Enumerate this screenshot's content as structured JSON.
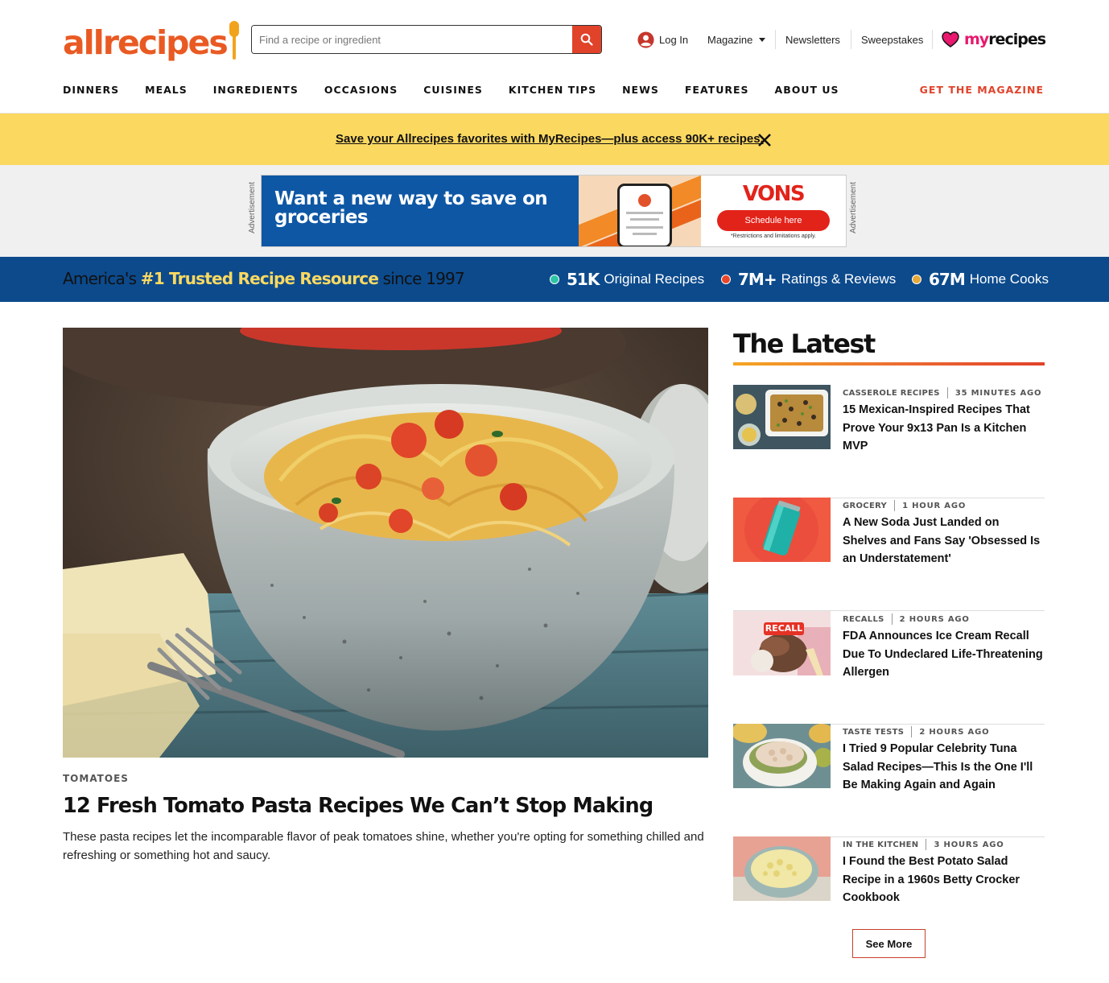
{
  "brand": {
    "logo_text": "allrecipes",
    "partner_logo_text_my": "my",
    "partner_logo_text_recipes": "recipes",
    "accent_color": "#e1422a"
  },
  "search": {
    "placeholder": "Find a recipe or ingredient",
    "icon": "search-icon"
  },
  "utility_nav": {
    "login": "Log In",
    "magazine": "Magazine",
    "newsletters": "Newsletters",
    "sweepstakes": "Sweepstakes"
  },
  "main_nav": {
    "items": [
      "DINNERS",
      "MEALS",
      "INGREDIENTS",
      "OCCASIONS",
      "CUISINES",
      "KITCHEN TIPS",
      "NEWS",
      "FEATURES",
      "ABOUT US"
    ],
    "cta": "GET THE MAGAZINE"
  },
  "promo": {
    "text": "Save your Allrecipes favorites with MyRecipes—plus access 90K+ recipes.",
    "close_icon": "close-icon"
  },
  "ad": {
    "label": "Advertisement",
    "headline": "Want a new way to save on groceries",
    "brand": "VONS",
    "button": "Schedule here",
    "fine_print": "*Restrictions and limitations apply."
  },
  "trust_banner": {
    "prefix": "America's ",
    "highlight": "#1 Trusted Recipe Resource",
    "suffix": " since 1997",
    "stats": [
      {
        "number": "51K",
        "label": "Original Recipes",
        "color": "#2ec4a6"
      },
      {
        "number": "7M+",
        "label": "Ratings & Reviews",
        "color": "#e8472a"
      },
      {
        "number": "67M",
        "label": "Home Cooks",
        "color": "#e6a93b"
      }
    ]
  },
  "feature": {
    "category": "TOMATOES",
    "title": "12 Fresh Tomato Pasta Recipes We Can’t Stop Making",
    "description": "These pasta recipes let the incomparable flavor of peak tomatoes shine, whether you're opting for something chilled and refreshing or something hot and saucy."
  },
  "latest": {
    "title": "The Latest",
    "items": [
      {
        "category": "CASSEROLE RECIPES",
        "time": "35 MINUTES AGO",
        "headline": "15 Mexican-Inspired Recipes That Prove Your 9x13 Pan Is a Kitchen MVP"
      },
      {
        "category": "GROCERY",
        "time": "1 HOUR AGO",
        "headline": "A New Soda Just Landed on Shelves and Fans Say 'Obsessed Is an Understatement'"
      },
      {
        "category": "RECALLS",
        "time": "2 HOURS AGO",
        "headline": "FDA Announces Ice Cream Recall Due To Undeclared Life-Threatening Allergen",
        "thumb_badge": "RECALL"
      },
      {
        "category": "TASTE TESTS",
        "time": "2 HOURS AGO",
        "headline": "I Tried 9 Popular Celebrity Tuna Salad Recipes—This Is the One I'll Be Making Again and Again"
      },
      {
        "category": "IN THE KITCHEN",
        "time": "3 HOURS AGO",
        "headline": "I Found the Best Potato Salad Recipe in a 1960s Betty Crocker Cookbook"
      }
    ],
    "see_more": "See More"
  }
}
